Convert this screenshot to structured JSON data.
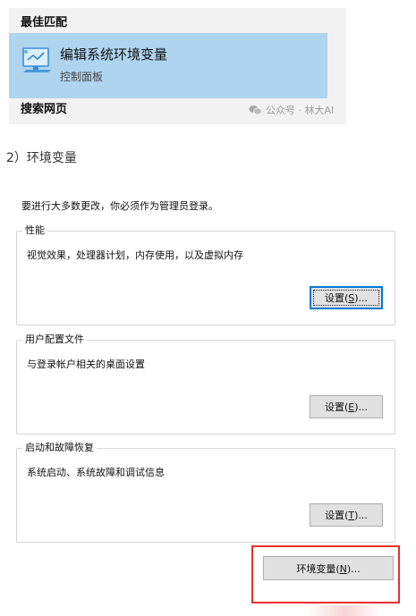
{
  "search": {
    "best_match_header": "最佳匹配",
    "best_match_item": {
      "title": "编辑系统环境变量",
      "subtitle": "控制面板",
      "icon": "control-panel-monitor-icon"
    },
    "web_header": "搜索网页",
    "watermark": "公众号 · 林大AI",
    "watermark_icon": "wechat-icon"
  },
  "step_caption": "2）环境变量",
  "dialog": {
    "admin_note": "要进行大多数更改，你必须作为管理员登录。",
    "performance": {
      "legend": "性能",
      "description": "视觉效果，处理器计划，内存使用，以及虚拟内存",
      "button": {
        "prefix": "设置(",
        "accel": "S",
        "suffix": ")..."
      }
    },
    "user_profiles": {
      "legend": "用户配置文件",
      "description": "与登录帐户相关的桌面设置",
      "button": {
        "prefix": "设置(",
        "accel": "E",
        "suffix": ")..."
      }
    },
    "startup_recovery": {
      "legend": "启动和故障恢复",
      "description": "系统启动、系统故障和调试信息",
      "button": {
        "prefix": "设置(",
        "accel": "T",
        "suffix": ")..."
      }
    },
    "env_button": {
      "prefix": "环境变量(",
      "accel": "N",
      "suffix": ")..."
    }
  },
  "colors": {
    "selection": "#aed4ee",
    "panel_bg": "#f2f2f2",
    "highlight": "#e8302f",
    "button_bg": "#e1e1e1",
    "focus": "#0078d7"
  }
}
